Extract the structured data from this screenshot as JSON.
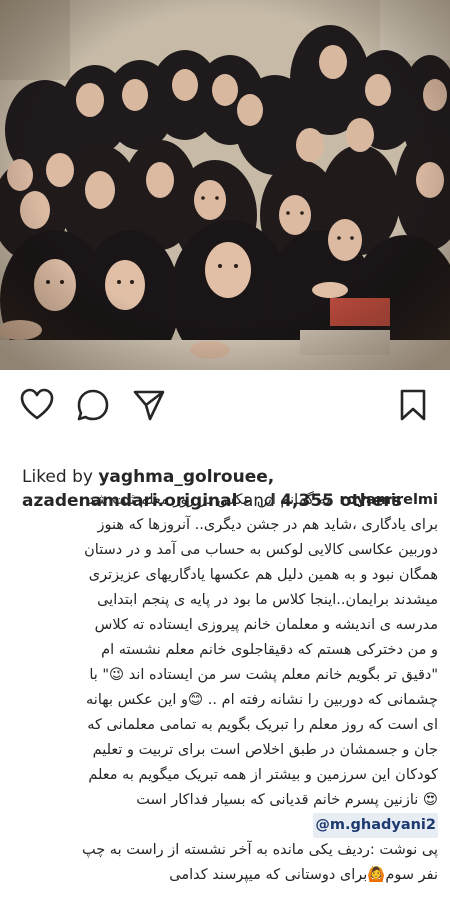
{
  "post": {
    "photo_alt": "vintage class photo",
    "liked_by_prefix": "Liked by ",
    "liked_user_1": "yaghma_golrouee,",
    "liked_user_2": "azadenamdari.original",
    "liked_and": " and ",
    "liked_count": "4,355 others",
    "caption_user": "royamirelmi",
    "caption_lines": [
      "به گمانم این عکس در روز معلم ثبت شد",
      "برای یادگاری ،شاید هم در جشن دیگری.. آنروزها که هنوز",
      "دوربین عکاسی کالایی لوکس به حساب می آمد و در دستان",
      "همگان نبود و به همین دلیل هم عکسها یادگاریهای عزیزتری",
      "میشدند برایمان..اینجا کلاس ما بود در پایه ی پنجم ابتدایی",
      "مدرسه ی اندیشه و معلمان خانم پیروزی ایستاده ته کلاس",
      "و من دخترکی هستم که دقیقاجلوی خانم معلم نشسته ام",
      "\"دقیق تر بگویم خانم معلم پشت سر من ایستاده اند 😉\" با",
      "چشمانی که دوربین را نشانه رفته ام .. 😊و این عکس بهانه",
      "ای است که روز معلم را تبریک بگویم به تمامی معلمانی که",
      "جان و جسمشان در طبق اخلاص است برای تربیت و تعلیم",
      "کودکان این سرزمین  و بیشتر از همه تبریک میگویم به معلم",
      "😍 نازنین پسرم خانم قدیانی که بسیار فداکار است",
      "@m.ghadyani2",
      "پی نوشت :ردیف یکی مانده به آخر نشسته از راست به چپ",
      "نفر سوم🙆برای دوستانی که میپرسند کدامی"
    ]
  }
}
